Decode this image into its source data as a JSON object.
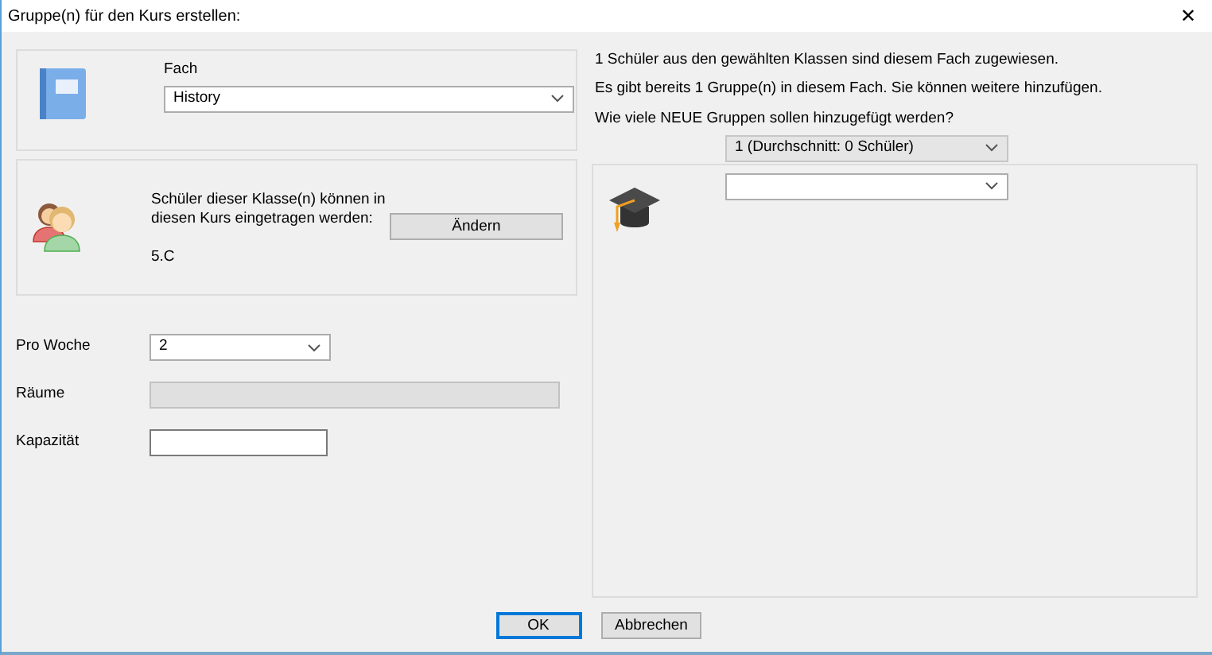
{
  "window": {
    "title": "Gruppe(n) für den Kurs erstellen:",
    "close": "✕"
  },
  "subject": {
    "label": "Fach",
    "value": "History"
  },
  "classes": {
    "text": "Schüler dieser Klasse(n) können in diesen Kurs eingetragen werden:",
    "value": "5.C",
    "button": "Ändern"
  },
  "fields": [
    {
      "label": "Pro Woche",
      "kind": "select",
      "value": "2"
    },
    {
      "label": "Räume",
      "kind": "input",
      "disabled": true
    },
    {
      "label": "Kapazität",
      "kind": "input",
      "disabled": false
    }
  ],
  "info": [
    "1 Schüler aus den gewählten Klassen sind diesem Fach zugewiesen.",
    "Es gibt bereits 1 Gruppe(n) in diesem Fach. Sie können weitere hinzufügen.",
    "Wie viele NEUE Gruppen sollen hinzugefügt werden?"
  ],
  "group_count": {
    "value": "1 (Durchschnitt: 0 Schüler)"
  },
  "buttons": [
    {
      "label": "OK",
      "default": true
    },
    {
      "label": "Abbrechen",
      "default": false
    }
  ]
}
